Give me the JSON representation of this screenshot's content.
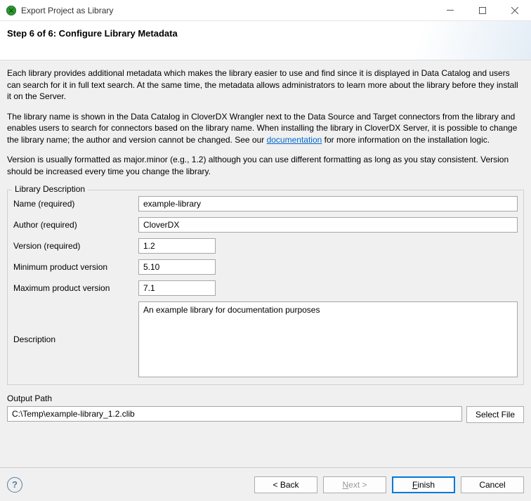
{
  "titlebar": {
    "title": "Export Project as Library"
  },
  "header": {
    "step_title": "Step 6 of 6: Configure Library Metadata"
  },
  "intro": {
    "p1": "Each library provides additional metadata which makes the library easier to use and find since it is displayed in Data Catalog and users can search for it in full text search. At the same time, the metadata allows administrators to learn more about the library before they install it on the Server.",
    "p2a": "The library name is shown in the Data Catalog in CloverDX Wrangler next to the Data Source and Target connectors from the library and enables users to search for connectors based on the library name. When installing the library in CloverDX Server, it is possible to change the library name; the author and version cannot be changed. See our ",
    "doc_link_text": "documentation",
    "p2b": " for more information on the installation logic.",
    "p3": "Version is usually formatted as major.minor (e.g., 1.2) although you can use different formatting as long as you stay consistent. Version should be increased every time you change the library."
  },
  "form": {
    "legend": "Library Description",
    "name_label": "Name (required)",
    "name_value": "example-library",
    "author_label": "Author (required)",
    "author_value": "CloverDX",
    "version_label": "Version (required)",
    "version_value": "1.2",
    "min_label": "Minimum product version",
    "min_value": "5.10",
    "max_label": "Maximum product version",
    "max_value": "7.1",
    "desc_label": "Description",
    "desc_value": "An example library for documentation purposes"
  },
  "output": {
    "label": "Output Path",
    "value": "C:\\Temp\\example-library_1.2.clib",
    "select_btn": "Select File"
  },
  "footer": {
    "back": "< Back",
    "next_prefix": "",
    "next_key": "N",
    "next_suffix": "ext >",
    "finish_prefix": "",
    "finish_key": "F",
    "finish_suffix": "inish",
    "cancel": "Cancel"
  }
}
